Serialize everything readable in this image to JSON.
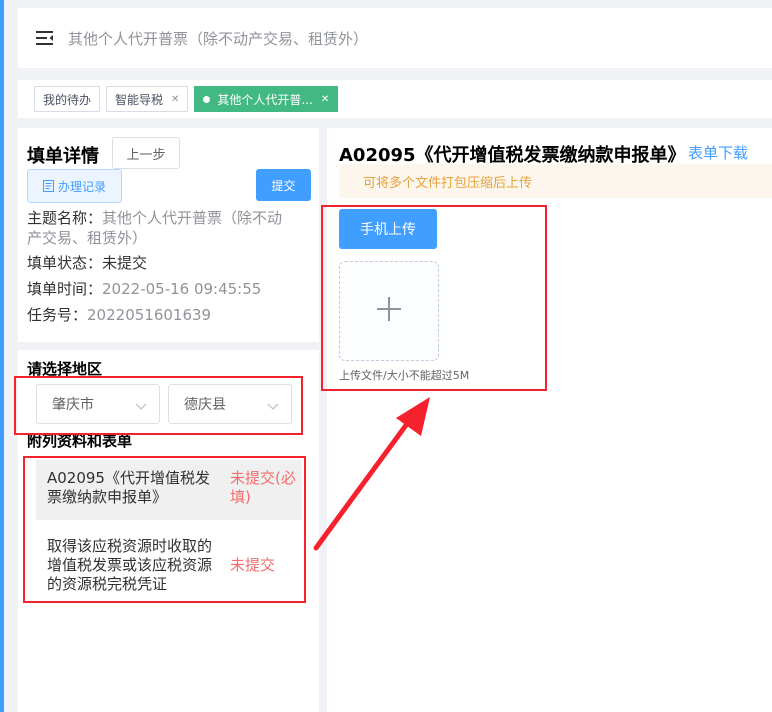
{
  "header": {
    "title": "其他个人代开普票（除不动产交易、租赁外）",
    "menu_icon": "menu-fold-icon"
  },
  "tags": [
    {
      "label": "我的待办",
      "closable": false,
      "active": false
    },
    {
      "label": "智能导税",
      "closable": true,
      "active": false
    },
    {
      "label": "其他个人代开普...",
      "closable": true,
      "active": true
    }
  ],
  "detail": {
    "title": "填单详情",
    "prev_label": "上一步",
    "record_label": "办理记录",
    "submit_label": "提交",
    "subject_label": "主题名称：",
    "subject_value_1": "其他个人代开普票（除不动",
    "subject_value_2": "产交易、租赁外）",
    "status_label": "填单状态：",
    "status_value": "未提交",
    "time_label": "填单时间：",
    "time_value": "2022-05-16 09:45:55",
    "task_label": "任务号：",
    "task_value": "2022051601639"
  },
  "region": {
    "title": "请选择地区",
    "city": "肇庆市",
    "county": "德庆县"
  },
  "attachments": {
    "title": "附列资料和表单",
    "items": [
      {
        "name": "A02095《代开增值税发票缴纳款申报单》",
        "status": "未提交(必填)"
      },
      {
        "name": "取得该应税资源时收取的增值税发票或该应税资源的资源税完税凭证",
        "status": "未提交"
      }
    ]
  },
  "form": {
    "title": "A02095《代开增值税发票缴纳款申报单》",
    "download_label": "表单下载",
    "tip": "可将多个文件打包压缩后上传",
    "mobile_upload_label": "手机上传",
    "upload_note": "上传文件/大小不能超过5M"
  },
  "colors": {
    "primary": "#409eff",
    "tag_active": "#42b983",
    "danger": "#f56c6c",
    "annotation": "#f5222d"
  }
}
